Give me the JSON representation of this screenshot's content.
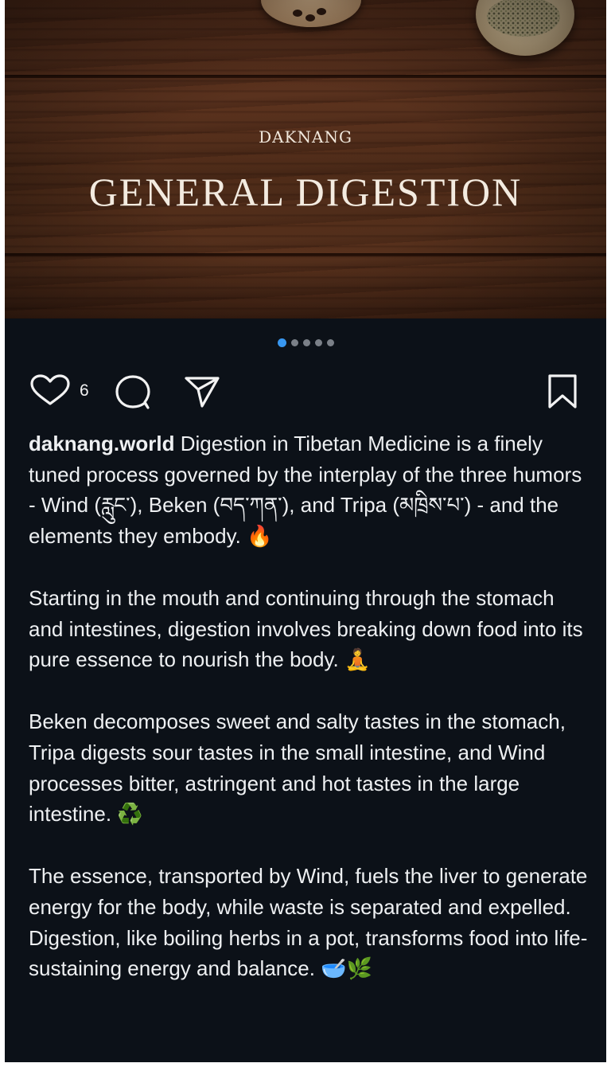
{
  "post": {
    "image": {
      "brand": "DAKNANG",
      "title": "GENERAL DIGESTION"
    },
    "carousel": {
      "count": 5,
      "active_index": 0
    },
    "actions": {
      "like_count": "6",
      "icons": [
        "heart-icon",
        "comment-icon",
        "share-icon",
        "bookmark-icon"
      ]
    },
    "caption": {
      "username": "daknang.world",
      "paragraphs": [
        {
          "text": "Digestion in Tibetan Medicine is a finely tuned process governed by the interplay of the three humors - Wind (རླུང་), Beken (བད་ཀན་), and Tripa (མཁྲིས་པ་) - and the elements they embody.",
          "emoji": "🔥"
        },
        {
          "text": "Starting in the mouth and continuing through the stomach and intestines, digestion involves breaking down food into its pure essence to nourish the body.",
          "emoji": "🧘"
        },
        {
          "text": "Beken decomposes sweet and salty tastes in the stomach, Tripa digests sour tastes in the small intestine, and Wind processes bitter, astringent and hot tastes in the large intestine.",
          "emoji": "♻️"
        },
        {
          "text": "The essence, transported by Wind, fuels the liver to generate energy for the body, while waste is separated and expelled. Digestion, like boiling herbs in a pot, transforms food into life-sustaining energy and balance.",
          "emoji": "🥣🌿"
        }
      ]
    },
    "colors": {
      "background": "#0c1118",
      "text": "#eef0f2",
      "active_dot": "#3897f0",
      "inactive_dot": "#7b8088"
    }
  }
}
